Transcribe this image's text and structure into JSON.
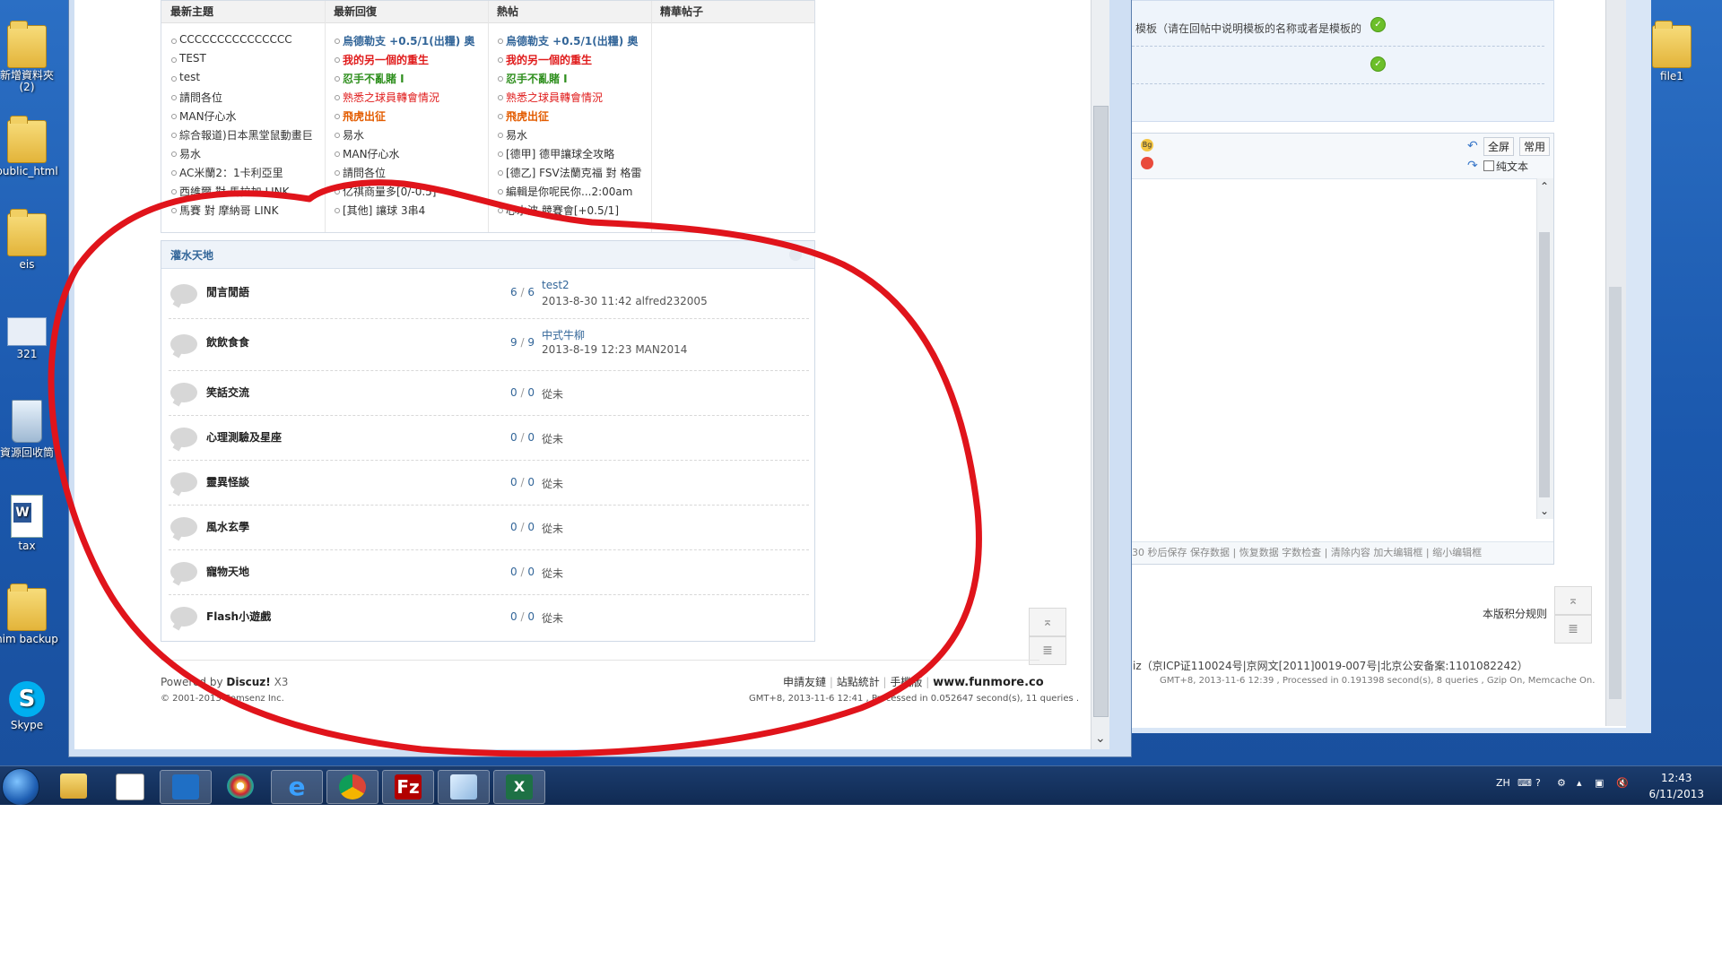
{
  "desktop": {
    "icons": [
      {
        "label": "新增資料夾\n(2)"
      },
      {
        "label": "public_html"
      },
      {
        "label": "eis"
      },
      {
        "label": "321"
      },
      {
        "label": "資源回收筒"
      },
      {
        "label": "tax"
      },
      {
        "label": "him backup"
      },
      {
        "label": "Skype"
      }
    ],
    "right_icon": "file1"
  },
  "main_window": {
    "columns": [
      "最新主題",
      "最新回復",
      "熱帖",
      "精華帖子"
    ],
    "latest_topics": [
      "CCCCCCCCCCCCCCC",
      "TEST",
      "test",
      "請問各位",
      "MAN仔心水",
      "綜合報道)日本黑堂鼠動畫巨",
      "易水",
      "AC米蘭2：1卡利亞里",
      "西維爾 對 馬拉加 LINK",
      "馬賽 對 摩納哥 LINK"
    ],
    "latest_replies": [
      {
        "text": "烏德勒支 +0.5/1(出糧) 奧",
        "color": "blue"
      },
      {
        "text": "我的另一個的重生",
        "color": "red"
      },
      {
        "text": "忍手不亂賭 I",
        "color": "green"
      },
      {
        "text": "熟悉之球員轉會情況",
        "color": "red"
      },
      {
        "text": "飛虎出征",
        "color": "orange"
      },
      {
        "text": "易水",
        "color": "plain"
      },
      {
        "text": "MAN仔心水",
        "color": "plain"
      },
      {
        "text": "請問各位",
        "color": "plain"
      },
      {
        "text": "亿祺商量多[0/-0.5]",
        "color": "plain"
      },
      {
        "text": "[其他] 讓球 3串4",
        "color": "plain"
      }
    ],
    "hot_posts": [
      {
        "text": "烏德勒支 +0.5/1(出糧) 奧",
        "color": "blue"
      },
      {
        "text": "我的另一個的重生",
        "color": "red"
      },
      {
        "text": "忍手不亂賭 I",
        "color": "green"
      },
      {
        "text": "熟悉之球員轉會情況",
        "color": "red"
      },
      {
        "text": "飛虎出征",
        "color": "orange"
      },
      {
        "text": "易水",
        "color": "plain"
      },
      {
        "text": "[德甲] 德甲讓球全攻略",
        "color": "plain"
      },
      {
        "text": "[德乙] FSV法蘭克福 對 格雷",
        "color": "plain"
      },
      {
        "text": "編輯是你呢民你...2:00am",
        "color": "plain"
      },
      {
        "text": "心水波 競賽會[+0.5/1]",
        "color": "plain"
      }
    ],
    "forum_section_title": "灌水天地",
    "forums": [
      {
        "name": "閒言閒語",
        "threads": "6",
        "posts": "6",
        "last_topic": "test2",
        "last_meta": "2013-8-30 11:42 alfred232005"
      },
      {
        "name": "飲飲食食",
        "threads": "9",
        "posts": "9",
        "last_topic": "中式牛柳",
        "last_meta": "2013-8-19 12:23 MAN2014"
      },
      {
        "name": "笑話交流",
        "threads": "0",
        "posts": "0",
        "last_topic": "",
        "last_meta": "從未"
      },
      {
        "name": "心理測驗及星座",
        "threads": "0",
        "posts": "0",
        "last_topic": "",
        "last_meta": "從未"
      },
      {
        "name": "靈異怪談",
        "threads": "0",
        "posts": "0",
        "last_topic": "",
        "last_meta": "從未"
      },
      {
        "name": "風水玄學",
        "threads": "0",
        "posts": "0",
        "last_topic": "",
        "last_meta": "從未"
      },
      {
        "name": "寵物天地",
        "threads": "0",
        "posts": "0",
        "last_topic": "",
        "last_meta": "從未"
      },
      {
        "name": "Flash小遊戲",
        "threads": "0",
        "posts": "0",
        "last_topic": "",
        "last_meta": "從未"
      }
    ],
    "footer": {
      "powered_prefix": "Powered by",
      "powered_brand": "Discuz!",
      "powered_version": "X3",
      "copyright": "© 2001-2013 Comsenz Inc.",
      "links": [
        "申請友鏈",
        "站點統計",
        "手機版"
      ],
      "site": "www.funmore.co",
      "processed": "GMT+8, 2013-11-6 12:41 , Processed in 0.052647 second(s), 11 queries ."
    }
  },
  "right_window": {
    "note": "模板（请在回帖中说明模板的名称或者是模板的",
    "btn_fullscreen": "全屏",
    "btn_common": "常用",
    "plaintext": "纯文本",
    "editor_footer": "30 秒后保存 保存数据 | 恢复数据    字数检查 | 清除内容    加大编辑框 | 缩小编辑框",
    "score_rule": "本版积分规则",
    "icp": "iz（京ICP证110024号|京网文[2011]0019-007号|北京公安备案:1101082242）",
    "processed": "GMT+8, 2013-11-6 12:39 , Processed in 0.191398 second(s), 8 queries , Gzip On, Memcache On."
  },
  "taskbar": {
    "lang": "ZH",
    "time": "12:43",
    "date": "6/11/2013"
  },
  "colors": {
    "annotation": "#e0141b",
    "link": "#336699",
    "taskbar": "#102a52",
    "desktop": "#1b58ad"
  }
}
